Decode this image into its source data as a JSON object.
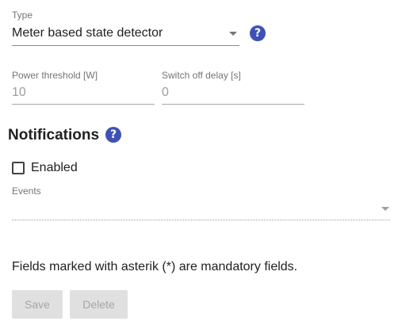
{
  "type_field": {
    "label": "Type",
    "value": "Meter based state detector",
    "help_glyph": "?"
  },
  "power_threshold": {
    "label": "Power threshold [W]",
    "value": "10"
  },
  "switch_off_delay": {
    "label": "Switch off delay [s]",
    "value": "0"
  },
  "notifications": {
    "title": "Notifications",
    "help_glyph": "?",
    "enabled_label": "Enabled",
    "enabled_checked": false,
    "events_label": "Events",
    "events_value": ""
  },
  "footer": {
    "mandatory_note": "Fields marked with asterik (*) are mandatory fields.",
    "save_label": "Save",
    "delete_label": "Delete"
  },
  "colors": {
    "help_icon": "#3f51b5",
    "disabled_button_bg": "#e0e0e0",
    "disabled_button_text": "#a6a6a6"
  }
}
